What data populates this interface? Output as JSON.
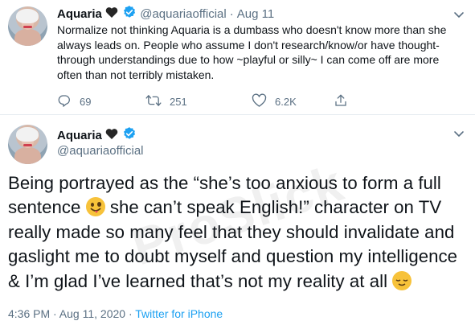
{
  "tweet1": {
    "author_name": "Aquaria",
    "handle": "@aquariaofficial",
    "date": "Aug 11",
    "text": "Normalize not thinking Aquaria is a dumbass who doesn't know more than she always leads on. People who assume I don't research/know/or have thought-through understandings due to how ~playful or silly~ I can come off are more often than not terribly mistaken.",
    "reply_count": "69",
    "retweet_count": "251",
    "like_count": "6.2K"
  },
  "tweet2": {
    "author_name": "Aquaria",
    "handle": "@aquariaofficial",
    "text_part1": "Being portrayed as the “she’s too anxious to form a full sentence ",
    "text_part2": " she can’t speak English!” character on TV really made so many feel that they should invalidate and gaslight me to doubt myself and question my intelligence & I’m glad I’ve learned that’s not my reality at all ",
    "timestamp": "4:36 PM · Aug 11, 2020 · ",
    "source": "Twitter for iPhone"
  },
  "watermark": "ProSlick",
  "icons": {
    "reply": "reply-icon",
    "retweet": "retweet-icon",
    "like": "like-icon",
    "share": "share-icon",
    "verified": "verified-badge-icon",
    "black_heart": "black-heart-icon",
    "chevron": "chevron-down-icon"
  },
  "colors": {
    "text": "#0f1419",
    "secondary": "#5b7083",
    "link": "#1da1f2",
    "verified": "#1da1f2"
  }
}
